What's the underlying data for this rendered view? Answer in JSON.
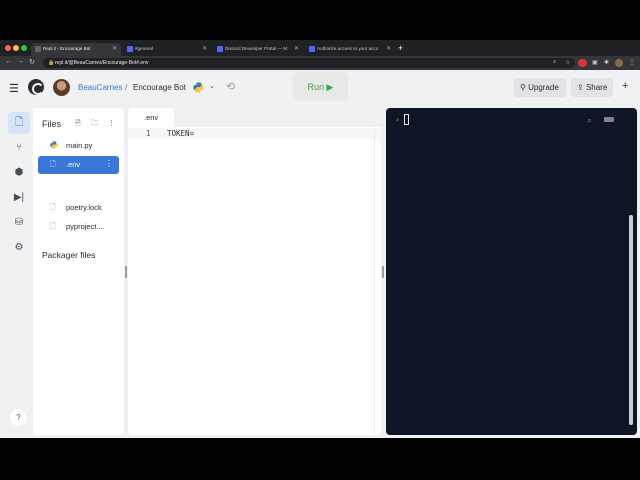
{
  "colors": {
    "accent": "#3b77d9",
    "run_green": "#3fa34d",
    "console_bg": "#0e1525"
  },
  "browser": {
    "tabs": [
      {
        "label": "Repl.it - Encourage Bot",
        "active": true
      },
      {
        "label": "#general"
      },
      {
        "label": "Discord Developer Portal — M"
      },
      {
        "label": "Authorize access to your acco"
      }
    ],
    "new_tab_icon": "plus-icon",
    "url": "repl.it/@BeauCarnes/Encourage-Bot#.env"
  },
  "header": {
    "user": "BeauCarnes",
    "separator": "/",
    "repl_name": "Encourage Bot",
    "run_label": "Run ▶",
    "upgrade_label": "Upgrade",
    "share_label": "Share"
  },
  "rail": {
    "icons": [
      "files-icon",
      "version-control-icon",
      "packages-icon",
      "debugger-icon",
      "database-icon",
      "settings-icon"
    ],
    "help": "?"
  },
  "files": {
    "title": "Files",
    "items": [
      {
        "name": "main.py",
        "icon": "python-icon"
      },
      {
        "name": ".env",
        "icon": "file-icon",
        "selected": true
      }
    ],
    "packager_title": "Packager files",
    "packager_items": [
      {
        "name": "poetry.lock",
        "icon": "file-icon"
      },
      {
        "name": "pyproject....",
        "icon": "file-icon"
      }
    ]
  },
  "editor": {
    "tab": ".env",
    "lines": [
      {
        "num": "1",
        "text": "TOKEN="
      }
    ]
  },
  "console": {
    "prompt": "›"
  }
}
